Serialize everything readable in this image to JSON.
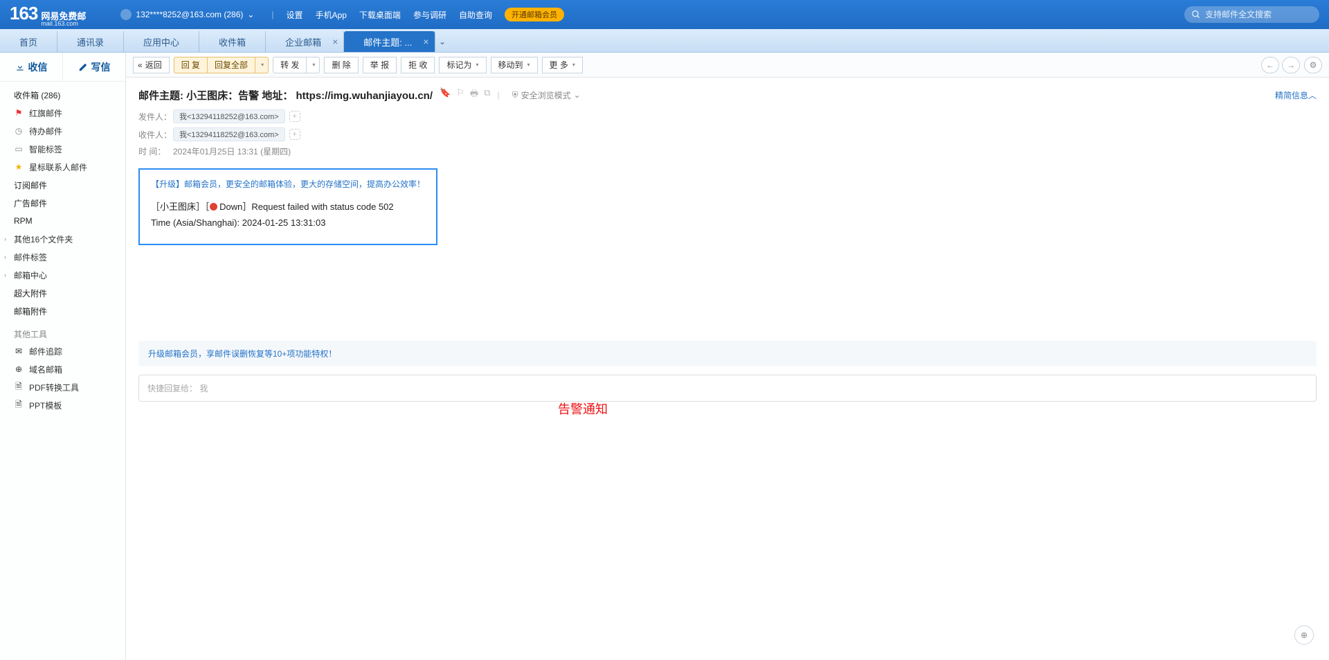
{
  "topbar": {
    "logo_num": "163",
    "logo_cn": "网易免费邮",
    "logo_en": "mail.163.com",
    "user": "132****8252@163.com (286)",
    "links": [
      "设置",
      "手机App",
      "下载桌面端",
      "参与调研",
      "自助查询"
    ],
    "vip_btn": "开通邮箱会员",
    "search_placeholder": "支持邮件全文搜索"
  },
  "tabs": {
    "items": [
      {
        "label": "首页",
        "closable": false
      },
      {
        "label": "通讯录",
        "closable": false
      },
      {
        "label": "应用中心",
        "closable": false
      },
      {
        "label": "收件箱",
        "closable": false
      },
      {
        "label": "企业邮箱",
        "closable": true
      },
      {
        "label": "邮件主题: ...",
        "closable": true,
        "active": true
      }
    ]
  },
  "sidebar": {
    "receive": "收信",
    "compose": "写信",
    "inbox": "收件箱 (286)",
    "flagged": "红旗邮件",
    "todo": "待办邮件",
    "smart": "智能标签",
    "starred": "星标联系人邮件",
    "subscribe": "订阅邮件",
    "ad": "广告邮件",
    "rpm": "RPM",
    "other_folders": "其他16个文件夹",
    "mail_tags": "邮件标签",
    "mail_center": "邮箱中心",
    "big_attach": "超大附件",
    "mail_attach": "邮箱附件",
    "other_tools": "其他工具",
    "track": "邮件追踪",
    "domain": "域名邮箱",
    "pdf": "PDF转换工具",
    "ppt": "PPT模板"
  },
  "toolbar": {
    "back": "返回",
    "reply": "回 复",
    "reply_all": "回复全部",
    "forward": "转 发",
    "delete": "删 除",
    "report": "举 报",
    "reject": "拒 收",
    "mark_as": "标记为",
    "move_to": "移动到",
    "more": "更 多"
  },
  "mail": {
    "subject": "邮件主题: 小王图床：告警 地址： https://img.wuhanjiayou.cn/",
    "safe_mode": "安全浏览模式",
    "simple_info": "精简信息",
    "from_label": "发件人：",
    "to_label": "收件人：",
    "time_label": "时   间：",
    "from_pill": "我<13294118252@163.com>",
    "to_pill": "我<13294118252@163.com>",
    "time": "2024年01月25日 13:31 (星期四)",
    "upgrade": "【升级】邮箱会员，更安全的邮箱体验，更大的存储空间，提高办公效率！",
    "body_line1_a": "［小王图床］［",
    "body_line1_b": " Down］Request failed with status code 502",
    "body_line2": "Time (Asia/Shanghai): 2024-01-25 13:31:03",
    "annotation": "告警通知",
    "footer_notice": "升级邮箱会员，享邮件误删恢复等10+项功能特权！",
    "reply_placeholder": "快捷回复给： 我"
  }
}
